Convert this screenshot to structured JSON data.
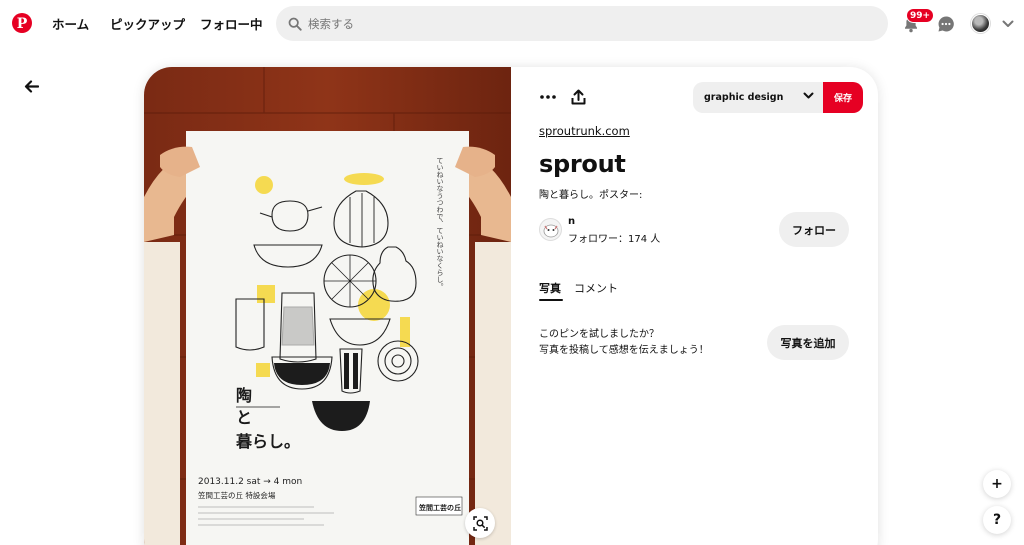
{
  "nav": {
    "logo_icon": "pinterest-logo-icon",
    "home": "ホーム",
    "pickup": "ピックアップ",
    "following": "フォロー中"
  },
  "search": {
    "placeholder": "検索する"
  },
  "notifications": {
    "badge": "99+"
  },
  "icons": {
    "bell": "bell-icon",
    "chat": "chat-icon",
    "chevron": "chevron-down-icon",
    "back": "back-arrow-icon",
    "more": "more-icon",
    "share": "share-icon",
    "lens": "visual-search-icon"
  },
  "colors": {
    "brand": "#e60023",
    "button_gray": "#efefef"
  },
  "pin": {
    "board": "graphic design",
    "save": "保存",
    "source": "sproutrunk.com",
    "title": "sprout",
    "description": "陶と暮らし。ポスター:",
    "creator": {
      "name": "n",
      "followers": "フォロワー：174 人"
    },
    "follow": "フォロー",
    "tabs": [
      {
        "label": "写真",
        "active": true
      },
      {
        "label": "コメント",
        "active": false
      }
    ],
    "tried_question": "このピンを試しましたか？",
    "tried_prompt": "写真を投稿して感想を伝えましょう！",
    "add_photo": "写真を追加"
  },
  "poster": {
    "vertical_text": "ていねいなうつわで、ていねいなくらし。",
    "title_lines": [
      "陶",
      "と",
      "暮らし。"
    ],
    "date": "2013.11.2 sat → 4 mon",
    "venue": "笠間工芸の丘 特設会場",
    "logo": "笠間工芸の丘"
  },
  "fab": {
    "plus": "+",
    "help": "?"
  }
}
